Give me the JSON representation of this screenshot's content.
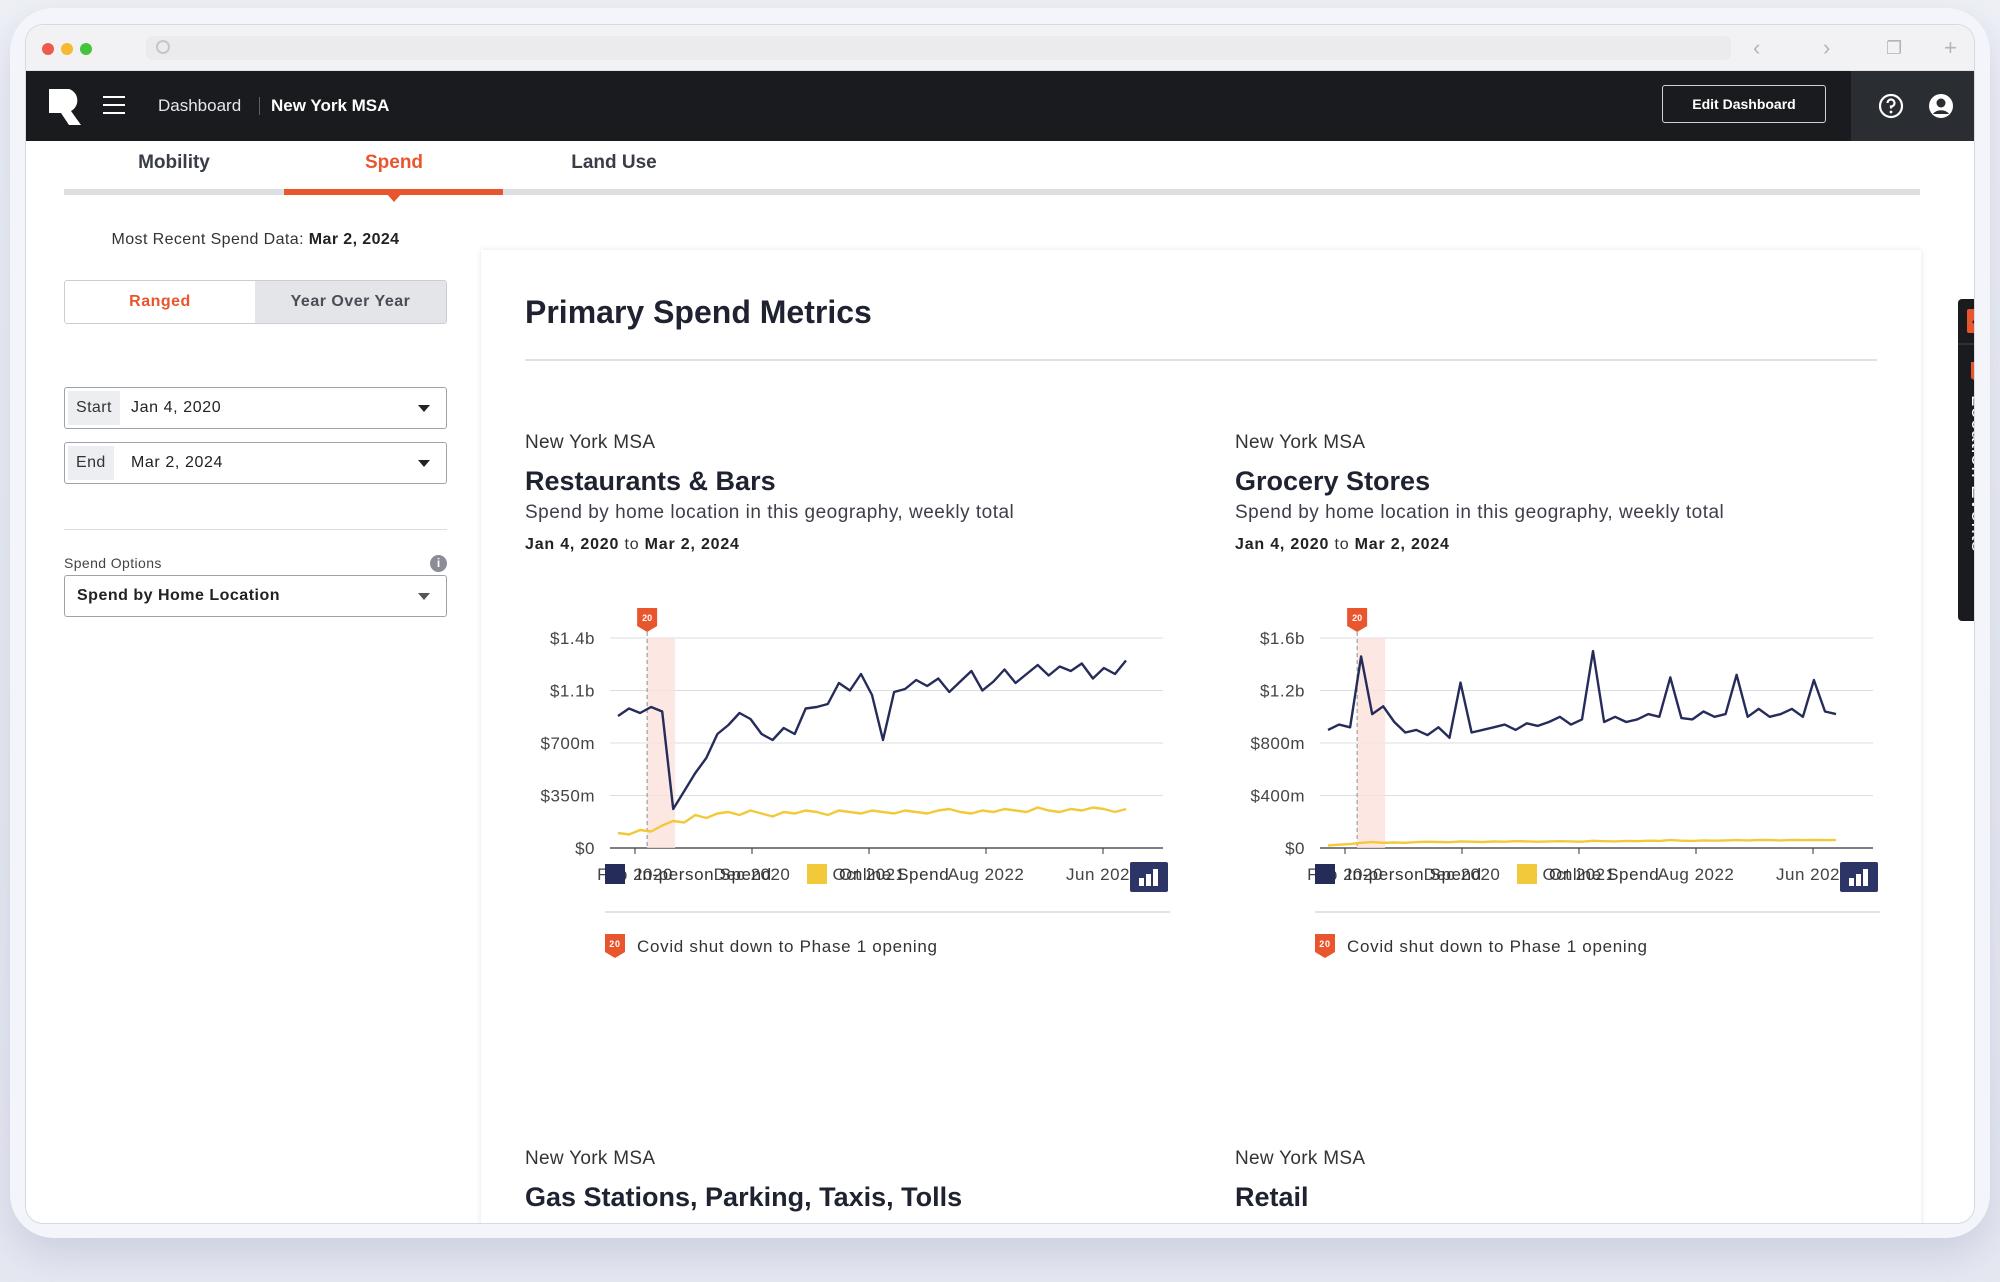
{
  "app": {
    "breadcrumb": [
      "Dashboard",
      "New York MSA"
    ],
    "edit_button": "Edit Dashboard",
    "colors": {
      "accent": "#e9552d",
      "nav_bg": "#191b1e",
      "series_inperson": "#252c5a",
      "series_online": "#f3c93c"
    }
  },
  "tabs": [
    {
      "label": "Mobility",
      "active": false
    },
    {
      "label": "Spend",
      "active": true
    },
    {
      "label": "Land Use",
      "active": false
    }
  ],
  "sidebar": {
    "recent_prefix": "Most Recent Spend Data:",
    "recent_date": "Mar 2, 2024",
    "toggle": [
      "Ranged",
      "Year Over Year"
    ],
    "start_label": "Start",
    "start_value": "Jan 4, 2020",
    "end_label": "End",
    "end_value": "Mar 2, 2024",
    "options_label": "Spend Options",
    "options_value": "Spend by Home Location"
  },
  "main": {
    "title": "Primary Spend Metrics",
    "panels": [
      {
        "geo": "New York MSA",
        "title": "Restaurants & Bars",
        "subtitle": "Spend by home location in this geography, weekly total",
        "range_start": "Jan 4, 2020",
        "range_to": "to",
        "range_end": "Mar 2, 2024"
      },
      {
        "geo": "New York MSA",
        "title": "Grocery Stores",
        "subtitle": "Spend by home location in this geography, weekly total",
        "range_start": "Jan 4, 2020",
        "range_to": "to",
        "range_end": "Mar 2, 2024"
      },
      {
        "geo": "New York MSA",
        "title": "Gas Stations, Parking, Taxis, Tolls"
      },
      {
        "geo": "New York MSA",
        "title": "Retail"
      }
    ],
    "legend": {
      "inperson": "In-person Spend",
      "online": "Online Spend"
    },
    "event_label": "Covid shut down to Phase 1 opening",
    "event_badge": "20"
  },
  "right_tab": {
    "label": "Location Events"
  },
  "chart_data": [
    {
      "type": "line",
      "title": "Restaurants & Bars",
      "x_ticks": [
        "Feb 2020",
        "Dec 2020",
        "Oct 2021",
        "Aug 2022",
        "Jun 2023"
      ],
      "y_ticks": [
        "$0",
        "$350m",
        "$700m",
        "$1.1b",
        "$1.4b"
      ],
      "y_tick_values": [
        0,
        350,
        700,
        1050,
        1400
      ],
      "ylim": [
        0,
        1400
      ],
      "y_units": "millions USD",
      "x_range": [
        "Jan 4, 2020",
        "Mar 2, 2024"
      ],
      "annotation": {
        "label": "20",
        "x": "Mar 2020"
      },
      "series": [
        {
          "name": "In-person Spend",
          "color": "#252c5a",
          "values": [
            880,
            930,
            900,
            940,
            910,
            260,
            380,
            500,
            600,
            760,
            820,
            900,
            860,
            760,
            720,
            800,
            760,
            930,
            940,
            960,
            1100,
            1050,
            1160,
            1020,
            720,
            1040,
            1060,
            1120,
            1080,
            1130,
            1040,
            1110,
            1180,
            1050,
            1110,
            1190,
            1100,
            1160,
            1220,
            1150,
            1210,
            1180,
            1230,
            1130,
            1200,
            1160,
            1250
          ]
        },
        {
          "name": "Online Spend",
          "color": "#f3c93c",
          "values": [
            100,
            90,
            120,
            110,
            150,
            180,
            170,
            220,
            200,
            230,
            240,
            220,
            250,
            230,
            210,
            240,
            230,
            250,
            240,
            220,
            250,
            240,
            230,
            250,
            240,
            230,
            250,
            240,
            230,
            250,
            260,
            240,
            230,
            250,
            240,
            260,
            250,
            240,
            270,
            250,
            240,
            260,
            250,
            270,
            260,
            240,
            260
          ]
        }
      ]
    },
    {
      "type": "line",
      "title": "Grocery Stores",
      "x_ticks": [
        "Feb 2020",
        "Dec 2020",
        "Oct 2021",
        "Aug 2022",
        "Jun 2023"
      ],
      "y_ticks": [
        "$0",
        "$400m",
        "$800m",
        "$1.2b",
        "$1.6b"
      ],
      "y_tick_values": [
        0,
        400,
        800,
        1200,
        1600
      ],
      "ylim": [
        0,
        1600
      ],
      "y_units": "millions USD",
      "x_range": [
        "Jan 4, 2020",
        "Mar 2, 2024"
      ],
      "annotation": {
        "label": "20",
        "x": "Mar 2020"
      },
      "series": [
        {
          "name": "In-person Spend",
          "color": "#252c5a",
          "values": [
            900,
            940,
            920,
            1460,
            1020,
            1080,
            960,
            880,
            900,
            860,
            920,
            840,
            1260,
            880,
            900,
            920,
            940,
            900,
            950,
            930,
            960,
            1000,
            940,
            980,
            1500,
            960,
            1000,
            960,
            980,
            1020,
            1000,
            1300,
            990,
            980,
            1040,
            1000,
            1020,
            1320,
            1000,
            1060,
            1000,
            1020,
            1060,
            1000,
            1280,
            1040,
            1020
          ]
        },
        {
          "name": "Online Spend",
          "color": "#f3c93c",
          "values": [
            20,
            25,
            30,
            40,
            45,
            40,
            42,
            40,
            45,
            48,
            46,
            44,
            50,
            48,
            46,
            50,
            48,
            52,
            50,
            48,
            50,
            52,
            50,
            48,
            55,
            52,
            50,
            54,
            52,
            56,
            54,
            60,
            56,
            54,
            58,
            56,
            58,
            60,
            58,
            62,
            60,
            58,
            62,
            60,
            62,
            60,
            60
          ]
        }
      ]
    }
  ]
}
